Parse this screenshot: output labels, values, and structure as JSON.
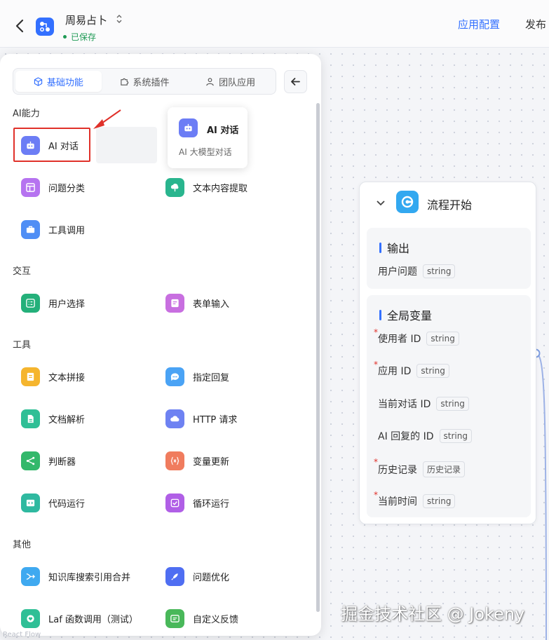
{
  "header": {
    "app_name": "周易占卜",
    "saved": "已保存",
    "config_link": "应用配置",
    "publish_link": "发布"
  },
  "tabs": [
    {
      "label": "基础功能",
      "active": true
    },
    {
      "label": "系统插件"
    },
    {
      "label": "团队应用"
    }
  ],
  "sections": {
    "ai": "AI能力",
    "interact": "交互",
    "tools": "工具",
    "other": "其他"
  },
  "items": {
    "ai_chat": "AI 对话",
    "classify": "问题分类",
    "extract": "文本内容提取",
    "tool_call": "工具调用",
    "user_select": "用户选择",
    "form_input": "表单输入",
    "text_concat": "文本拼接",
    "reply": "指定回复",
    "doc_parse": "文档解析",
    "http": "HTTP 请求",
    "judge": "判断器",
    "var_update": "变量更新",
    "code_run": "代码运行",
    "loop_run": "循环运行",
    "kb_merge": "知识库搜索引用合并",
    "question_opt": "问题优化",
    "laf_call": "Laf 函数调用（测试）",
    "feedback": "自定义反馈"
  },
  "tooltip": {
    "title": "AI 对话",
    "desc": "AI 大模型对话"
  },
  "node": {
    "title": "流程开始",
    "output_title": "输出",
    "output_rows": [
      {
        "label": "用户问题",
        "type": "string"
      }
    ],
    "global_title": "全局变量",
    "global_rows": [
      {
        "label": "使用者 ID",
        "type": "string",
        "required": true
      },
      {
        "label": "应用 ID",
        "type": "string",
        "required": true
      },
      {
        "label": "当前对话 ID",
        "type": "string",
        "required": false
      },
      {
        "label": "AI 回复的 ID",
        "type": "string",
        "required": false
      },
      {
        "label": "历史记录",
        "type": "历史记录",
        "required": true
      },
      {
        "label": "当前时间",
        "type": "string",
        "required": true
      }
    ],
    "required_mark": "*"
  },
  "watermark": "掘金技术社区 @ Jokeny",
  "footer": "React Flow",
  "colors": {
    "accent": "#3370ff",
    "highlight": "#e0312a",
    "saved": "#1f9a55"
  }
}
